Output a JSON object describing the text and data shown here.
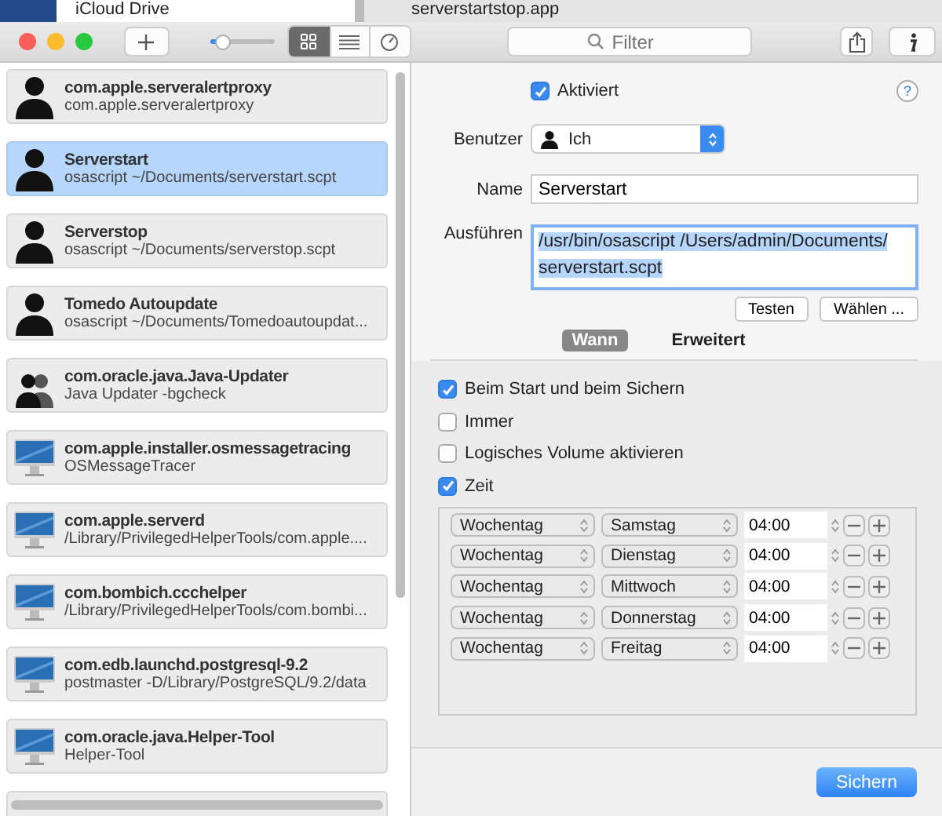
{
  "background_window": {
    "sidebar_item": "iCloud Drive",
    "file_name": "serverstartstop.app"
  },
  "toolbar": {
    "zoom_slider": {
      "level": 0.2
    },
    "view_modes": [
      {
        "kind": "grid",
        "selected": true
      },
      {
        "kind": "list",
        "selected": false
      },
      {
        "kind": "gauge",
        "selected": false
      }
    ],
    "search": {
      "placeholder": "Filter"
    }
  },
  "jobs": [
    {
      "kind": "user",
      "title": "com.apple.serveralertproxy",
      "subtitle": "com.apple.serveralertproxy",
      "selected": false
    },
    {
      "kind": "user",
      "title": "Serverstart",
      "subtitle": "osascript ~/Documents/serverstart.scpt",
      "selected": true
    },
    {
      "kind": "user",
      "title": "Serverstop",
      "subtitle": "osascript ~/Documents/serverstop.scpt",
      "selected": false
    },
    {
      "kind": "user",
      "title": "Tomedo Autoupdate",
      "subtitle": "osascript ~/Documents/Tomedoautoupdat...",
      "selected": false
    },
    {
      "kind": "group",
      "title": "com.oracle.java.Java-Updater",
      "subtitle": "Java Updater -bgcheck",
      "selected": false
    },
    {
      "kind": "system",
      "title": "com.apple.installer.osmessagetracing",
      "subtitle": "OSMessageTracer",
      "selected": false
    },
    {
      "kind": "system",
      "title": "com.apple.serverd",
      "subtitle": "/Library/PrivilegedHelperTools/com.apple....",
      "selected": false
    },
    {
      "kind": "system",
      "title": "com.bombich.ccchelper",
      "subtitle": "/Library/PrivilegedHelperTools/com.bombi...",
      "selected": false
    },
    {
      "kind": "system",
      "title": "com.edb.launchd.postgresql-9.2",
      "subtitle": "postmaster -D/Library/PostgreSQL/9.2/data",
      "selected": false
    },
    {
      "kind": "system",
      "title": "com.oracle.java.Helper-Tool",
      "subtitle": "Helper-Tool",
      "selected": false
    }
  ],
  "detail": {
    "help_button": "?",
    "enabled": {
      "label": "Aktiviert",
      "checked": true
    },
    "user": {
      "label": "Benutzer",
      "value": "Ich"
    },
    "name": {
      "label": "Name",
      "value": "Serverstart"
    },
    "run": {
      "label": "Ausführen",
      "value": "/usr/bin/osascript /Users/admin/Documents/ serverstart.scpt"
    },
    "buttons": [
      "Testen",
      "Wählen ..."
    ],
    "tabs": [
      {
        "label": "Wann",
        "selected": true
      },
      {
        "label": "Erweitert",
        "selected": false
      }
    ],
    "triggers": [
      {
        "label": "Beim Start und beim Sichern",
        "checked": true
      },
      {
        "label": "Immer",
        "checked": false
      },
      {
        "label": "Logisches Volume aktivieren",
        "checked": false
      },
      {
        "label": "Zeit",
        "checked": true
      }
    ],
    "schedule": [
      {
        "period": "Wochentag",
        "day": "Samstag",
        "time": "04:00"
      },
      {
        "period": "Wochentag",
        "day": "Dienstag",
        "time": "04:00"
      },
      {
        "period": "Wochentag",
        "day": "Mittwoch",
        "time": "04:00"
      },
      {
        "period": "Wochentag",
        "day": "Donnerstag",
        "time": "04:00"
      },
      {
        "period": "Wochentag",
        "day": "Freitag",
        "time": "04:00"
      }
    ],
    "save_button": "Sichern"
  }
}
